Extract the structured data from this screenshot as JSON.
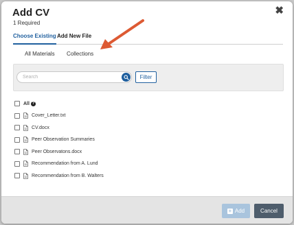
{
  "dialog": {
    "title": "Add CV",
    "subtitle": "1 Required"
  },
  "tabs": [
    {
      "label": "Choose Existing",
      "active": true
    },
    {
      "label": "Add New File",
      "active": false
    }
  ],
  "subtabs": [
    {
      "label": "All Materials"
    },
    {
      "label": "Collections"
    }
  ],
  "search": {
    "placeholder": "Search",
    "value": "",
    "filter_label": "Filter"
  },
  "select_all": {
    "label": "All",
    "checked": false
  },
  "files": [
    {
      "name": "Cover_Letter.txt",
      "checked": false
    },
    {
      "name": "CV.docx",
      "checked": false
    },
    {
      "name": "Peer Observation Summaries",
      "checked": false
    },
    {
      "name": "Peer Observatons.docx",
      "checked": false
    },
    {
      "name": "Recommendation from A. Lund",
      "checked": false
    },
    {
      "name": "Recommendation from B. Walters",
      "checked": false
    }
  ],
  "footer": {
    "add_label": "Add",
    "cancel_label": "Cancel",
    "add_enabled": false
  },
  "colors": {
    "accent": "#1f5f9e",
    "add_disabled": "#a9c4dd",
    "cancel": "#4e5d6c",
    "annotation_arrow": "#dd5a33"
  },
  "icons": {
    "close": "close-icon",
    "search": "search-icon",
    "help": "help-icon",
    "file": "document-icon",
    "plus": "plus-icon"
  }
}
